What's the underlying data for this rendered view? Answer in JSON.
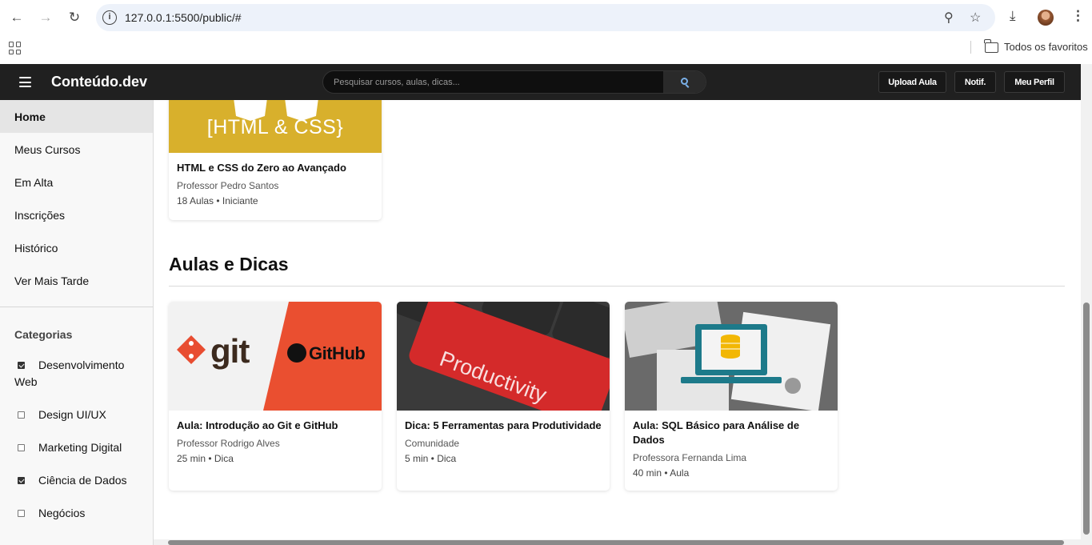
{
  "browser": {
    "url": "127.0.0.1:5500/public/#",
    "bookmarks_folder": "Todos os favoritos"
  },
  "header": {
    "brand": "Conteúdo.dev",
    "search_placeholder": "Pesquisar cursos, aulas, dicas...",
    "upload_label": "Upload Aula",
    "notif_label": "Notif.",
    "profile_label": "Meu Perfil"
  },
  "sidebar": {
    "items": [
      {
        "label": "Home",
        "active": true
      },
      {
        "label": "Meus Cursos"
      },
      {
        "label": "Em Alta"
      },
      {
        "label": "Inscrições"
      },
      {
        "label": "Histórico"
      },
      {
        "label": "Ver Mais Tarde"
      }
    ],
    "categories_title": "Categorias",
    "categories": [
      {
        "label": "Desenvolvimento Web",
        "checked": true
      },
      {
        "label": "Design UI/UX",
        "checked": false
      },
      {
        "label": "Marketing Digital",
        "checked": false
      },
      {
        "label": "Ciência de Dados",
        "checked": true
      },
      {
        "label": "Negócios",
        "checked": false
      }
    ]
  },
  "course_card": {
    "thumb_text": "[HTML & CSS}",
    "title": "HTML e CSS do Zero ao Avançado",
    "author": "Professor Pedro Santos",
    "meta": "18 Aulas • Iniciante"
  },
  "tips_section": {
    "title": "Aulas e Dicas",
    "cards": [
      {
        "title": "Aula: Introdução ao Git e GitHub",
        "author": "Professor Rodrigo Alves",
        "meta": "25 min • Dica",
        "thumb_git": "git",
        "thumb_github": "GitHub"
      },
      {
        "title": "Dica: 5 Ferramentas para Produtividade",
        "author": "Comunidade",
        "meta": "5 min • Dica",
        "thumb_text": "Productivity"
      },
      {
        "title": "Aula: SQL Básico para Análise de Dados",
        "author": "Professora Fernanda Lima",
        "meta": "40 min • Aula"
      }
    ]
  }
}
